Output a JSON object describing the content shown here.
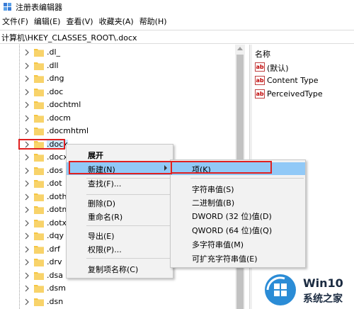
{
  "window": {
    "title": "注册表编辑器"
  },
  "menubar": {
    "items": [
      "文件(F)",
      "编辑(E)",
      "查看(V)",
      "收藏夹(A)",
      "帮助(H)"
    ]
  },
  "address": {
    "path": "计算机\\HKEY_CLASSES_ROOT\\.docx"
  },
  "tree": {
    "items": [
      ".dl_",
      ".dll",
      ".dng",
      ".doc",
      ".dochtml",
      ".docm",
      ".docmhtml",
      ".docx",
      ".docx",
      ".dos",
      ".dot",
      ".doth",
      ".dotm",
      ".dotx",
      ".dqy",
      ".drf",
      ".drv",
      ".dsa",
      ".dsm",
      ".dsn"
    ],
    "selected": ".docx"
  },
  "values": {
    "column_header": "名称",
    "icon_label": "ab",
    "rows": [
      "(默认)",
      "Content Type",
      "PerceivedType"
    ]
  },
  "context_menu": {
    "items": [
      "展开",
      "新建(N)",
      "查找(F)...",
      "删除(D)",
      "重命名(R)",
      "导出(E)",
      "权限(P)...",
      "复制项名称(C)"
    ]
  },
  "submenu": {
    "items": [
      "项(K)",
      "字符串值(S)",
      "二进制值(B)",
      "DWORD (32 位)值(D)",
      "QWORD (64 位)值(Q)",
      "多字符串值(M)",
      "可扩充字符串值(E)"
    ]
  },
  "watermark": {
    "line1": "Win10",
    "line2": "系统之家"
  },
  "colors": {
    "highlight": "#91c9f7",
    "annotation_red": "#e02020",
    "folder_yellow": "#f5c542",
    "menu_bg": "#f2f2f2"
  }
}
